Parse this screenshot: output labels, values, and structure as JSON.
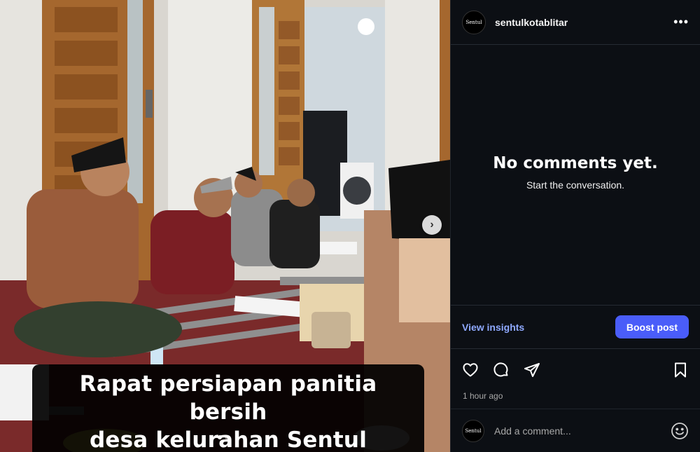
{
  "post": {
    "media": {
      "caption_lines": [
        "Rapat persiapan panitia bersih",
        "desa kelurahan Sentul"
      ],
      "carousel": {
        "count": 2,
        "active": 1
      }
    },
    "author": {
      "username": "sentulkotablitar",
      "avatar_text": "Sentul"
    },
    "comments": {
      "empty_title": "No comments yet.",
      "empty_subtitle": "Start the conversation."
    },
    "insights_label": "View insights",
    "boost_label": "Boost post",
    "timestamp": "1 hour ago",
    "add_comment": {
      "placeholder": "Add a comment..."
    }
  },
  "colors": {
    "accent": "#4a5df9",
    "link": "#8fa9ff",
    "panel_bg": "#0c0f14"
  }
}
